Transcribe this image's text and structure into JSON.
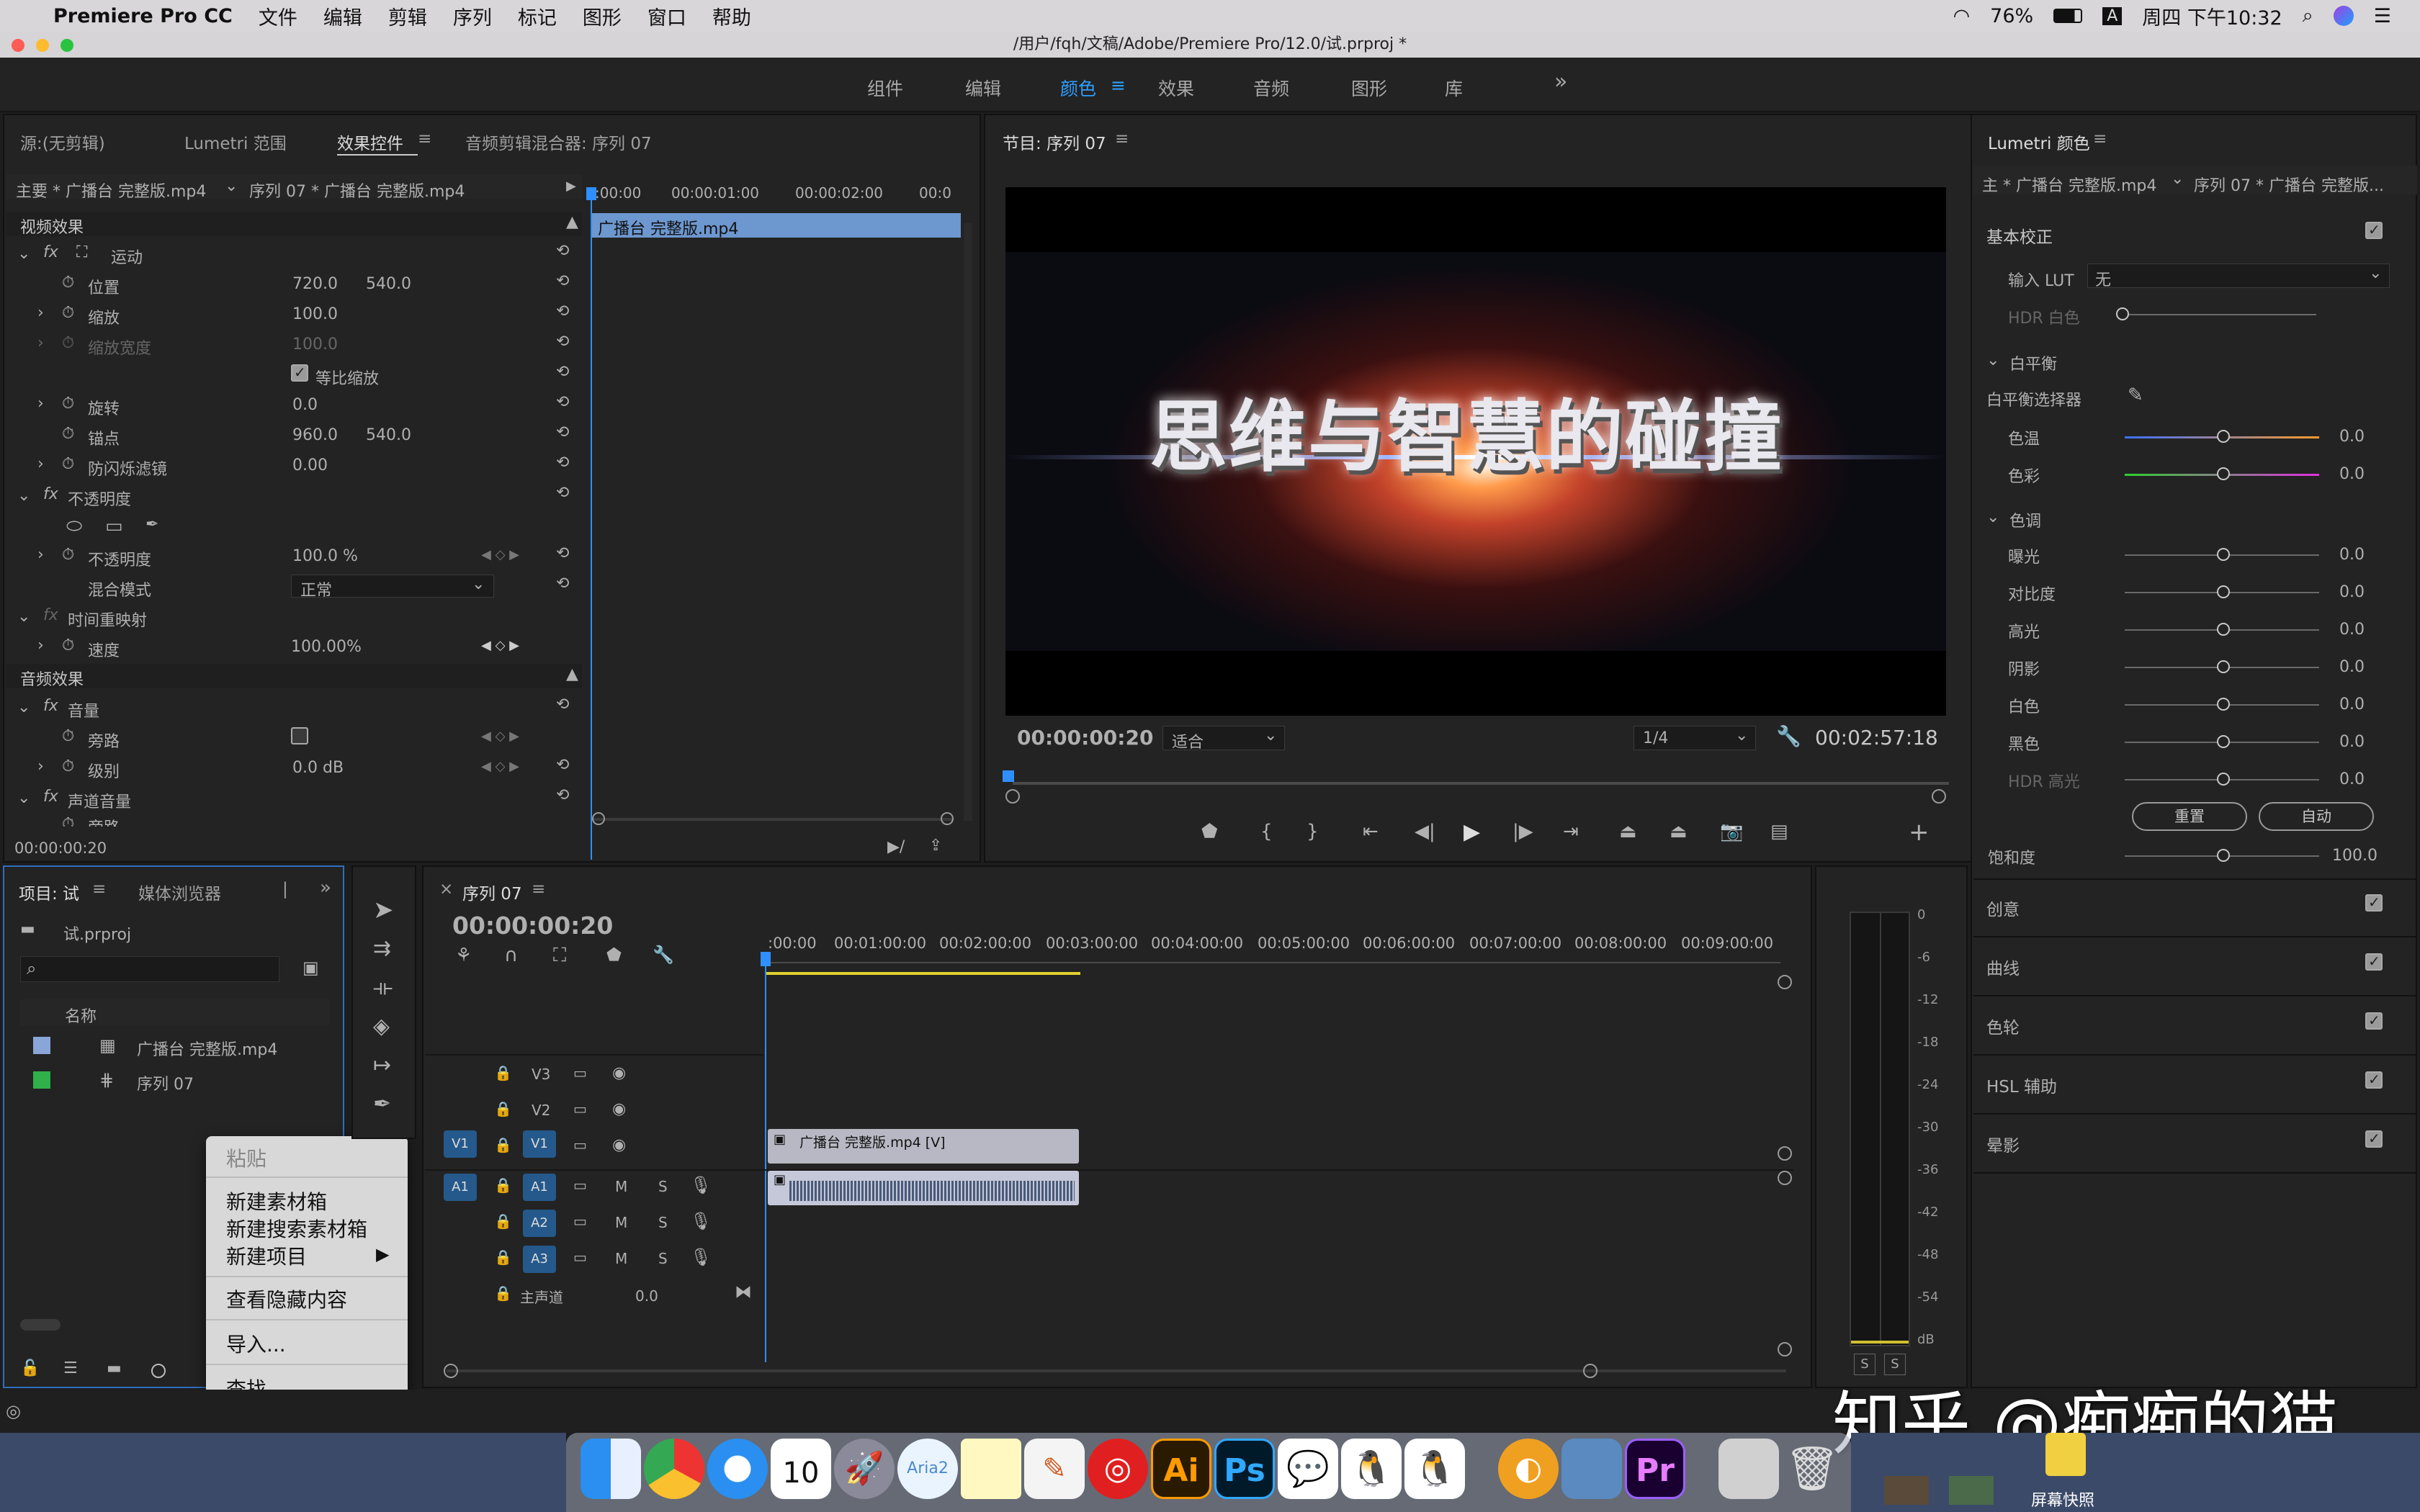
{
  "menubar": {
    "app": "Premiere Pro CC",
    "items": [
      "文件",
      "编辑",
      "剪辑",
      "序列",
      "标记",
      "图形",
      "窗口",
      "帮助"
    ],
    "battery": "76%",
    "clock": "周四 下午10:32"
  },
  "titlebar": {
    "path": "/用户/fqh/文稿/Adobe/Premiere Pro/12.0/试.prproj *"
  },
  "workspaces": [
    "组件",
    "编辑",
    "颜色",
    "效果",
    "音频",
    "图形",
    "库"
  ],
  "workspace_more": "»",
  "source_panel": {
    "tabs": [
      "源:(无剪辑)",
      "Lumetri 范围",
      "效果控件",
      "音频剪辑混合器: 序列 07"
    ],
    "master": "主要 * 广播台 完整版.mp4",
    "seq_clip": "序列 07 * 广播台 完整版.mp4",
    "ruler": [
      ":00:00",
      "00:00:01:00",
      "00:00:02:00",
      "00:0"
    ],
    "clip_bar": "广播台 完整版.mp4",
    "video_header": "视频效果",
    "motion": "运动",
    "position_label": "位置",
    "position_x": "720.0",
    "position_y": "540.0",
    "scale_label": "缩放",
    "scale_val": "100.0",
    "scale_w_label": "缩放宽度",
    "scale_w_val": "100.0",
    "uniform_label": "等比缩放",
    "rotation_label": "旋转",
    "rotation_val": "0.0",
    "anchor_label": "锚点",
    "anchor_x": "960.0",
    "anchor_y": "540.0",
    "flicker_label": "防闪烁滤镜",
    "flicker_val": "0.00",
    "opacity_header": "不透明度",
    "opacity_label": "不透明度",
    "opacity_val": "100.0 %",
    "blend_label": "混合模式",
    "blend_val": "正常",
    "timeremap_header": "时间重映射",
    "speed_label": "速度",
    "speed_val": "100.00%",
    "audio_header": "音频效果",
    "volume_header": "音量",
    "bypass_label": "旁路",
    "level_label": "级别",
    "level_val": "0.0 dB",
    "chvol_header": "声道音量",
    "chbypass_label": "旁路",
    "timecode": "00:00:00:20"
  },
  "program": {
    "title": "节目: 序列 07",
    "video_text": "思维与智慧的碰撞",
    "timecode": "00:00:00:20",
    "fit": "适合",
    "quality": "1/4",
    "duration": "00:02:57:18"
  },
  "lumetri": {
    "title": "Lumetri 颜色",
    "master": "主 * 广播台 完整版.mp4",
    "seq_clip": "序列 07 * 广播台 完整版...",
    "basic": "基本校正",
    "lut_label": "输入 LUT",
    "lut_val": "无",
    "hdr_label": "HDR 白色",
    "hdr_val": "100",
    "wb_header": "白平衡",
    "wb_picker": "白平衡选择器",
    "temp_label": "色温",
    "temp_val": "0.0",
    "tint_label": "色彩",
    "tint_val": "0.0",
    "tone_header": "色调",
    "exposure_label": "曝光",
    "exposure_val": "0.0",
    "contrast_label": "对比度",
    "contrast_val": "0.0",
    "highlights_label": "高光",
    "highlights_val": "0.0",
    "shadows_label": "阴影",
    "shadows_val": "0.0",
    "whites_label": "白色",
    "whites_val": "0.0",
    "blacks_label": "黑色",
    "blacks_val": "0.0",
    "hdrspec_label": "HDR 高光",
    "hdrspec_val": "0.0",
    "reset": "重置",
    "auto": "自动",
    "saturation_label": "饱和度",
    "saturation_val": "100.0",
    "sections": [
      "创意",
      "曲线",
      "色轮",
      "HSL 辅助",
      "晕影"
    ]
  },
  "project": {
    "tabs": [
      "项目: 试",
      "媒体浏览器"
    ],
    "file": "试.prproj",
    "col_name": "名称",
    "items": [
      "广播台 完整版.mp4",
      "序列 07"
    ],
    "colors": [
      "#8aa6d8",
      "#2fb04a"
    ]
  },
  "context_menu": {
    "paste": "粘贴",
    "new_bin": "新建素材箱",
    "new_search_bin": "新建搜索素材箱",
    "new_item": "新建项目",
    "show_hidden": "查看隐藏内容",
    "import": "导入...",
    "find": "查找..."
  },
  "timeline": {
    "title": "序列 07",
    "timecode": "00:00:00:20",
    "ruler": [
      ":00:00",
      "00:01:00:00",
      "00:02:00:00",
      "00:03:00:00",
      "00:04:00:00",
      "00:05:00:00",
      "00:06:00:00",
      "00:07:00:00",
      "00:08:00:00",
      "00:09:00:00"
    ],
    "tracks": [
      "V3",
      "V2",
      "V1",
      "A1",
      "A2",
      "A3"
    ],
    "src_v": "V1",
    "src_a": "A1",
    "mute": "M",
    "solo": "S",
    "master_label": "主声道",
    "master_val": "0.0",
    "video_clip": "广播台 完整版.mp4 [V]"
  },
  "meter": {
    "scale": [
      "0",
      "-6",
      "-12",
      "-18",
      "-24",
      "-30",
      "-36",
      "-42",
      "-48",
      "-54",
      "dB"
    ],
    "solo": [
      "S",
      "S"
    ]
  },
  "watermark": "知乎 @痴痴的猫",
  "dock": {
    "screenshot_label": "屏幕快照",
    "calendar_day": "10",
    "aria": "Aria2",
    "ai": "Ai",
    "ps": "Ps",
    "pr": "Pr"
  }
}
